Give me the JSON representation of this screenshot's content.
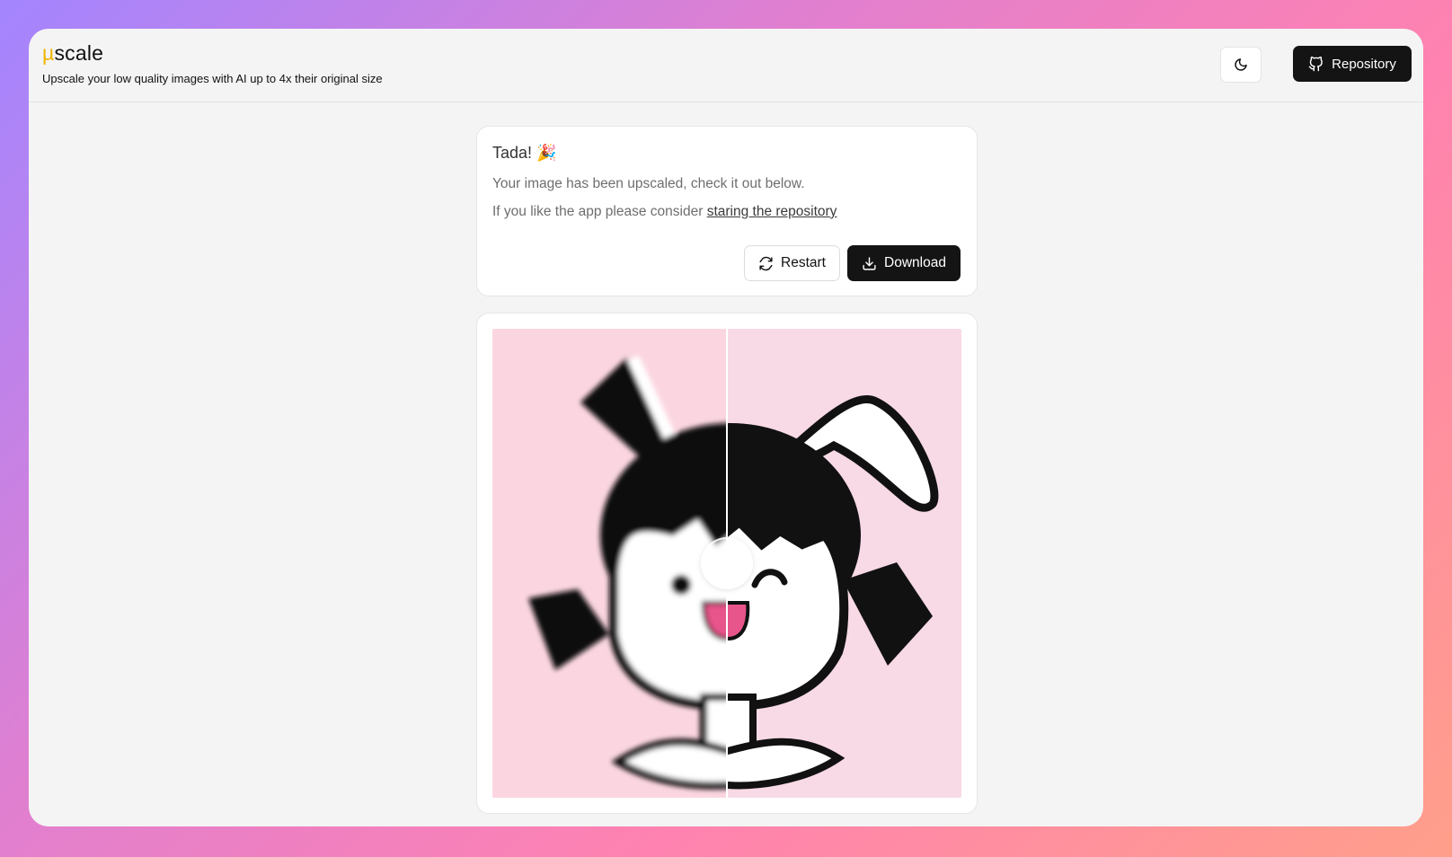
{
  "header": {
    "logo_mu": "µ",
    "logo_rest": "scale",
    "tagline": "Upscale your low quality images with AI up to 4x their original size",
    "repo_label": "Repository"
  },
  "message": {
    "title": "Tada! 🎉",
    "line1": "Your image has been upscaled, check it out below.",
    "line2_prefix": "If you like the app please consider ",
    "line2_link": "staring the repository",
    "restart_label": "Restart",
    "download_label": "Download"
  },
  "compare": {
    "slider_position": 0.5,
    "left_bg": "#fbd6e0",
    "right_bg": "#f8d9e6"
  },
  "icons": {
    "theme": "moon-icon",
    "repo": "github-icon",
    "restart": "refresh-icon",
    "download": "download-icon"
  }
}
